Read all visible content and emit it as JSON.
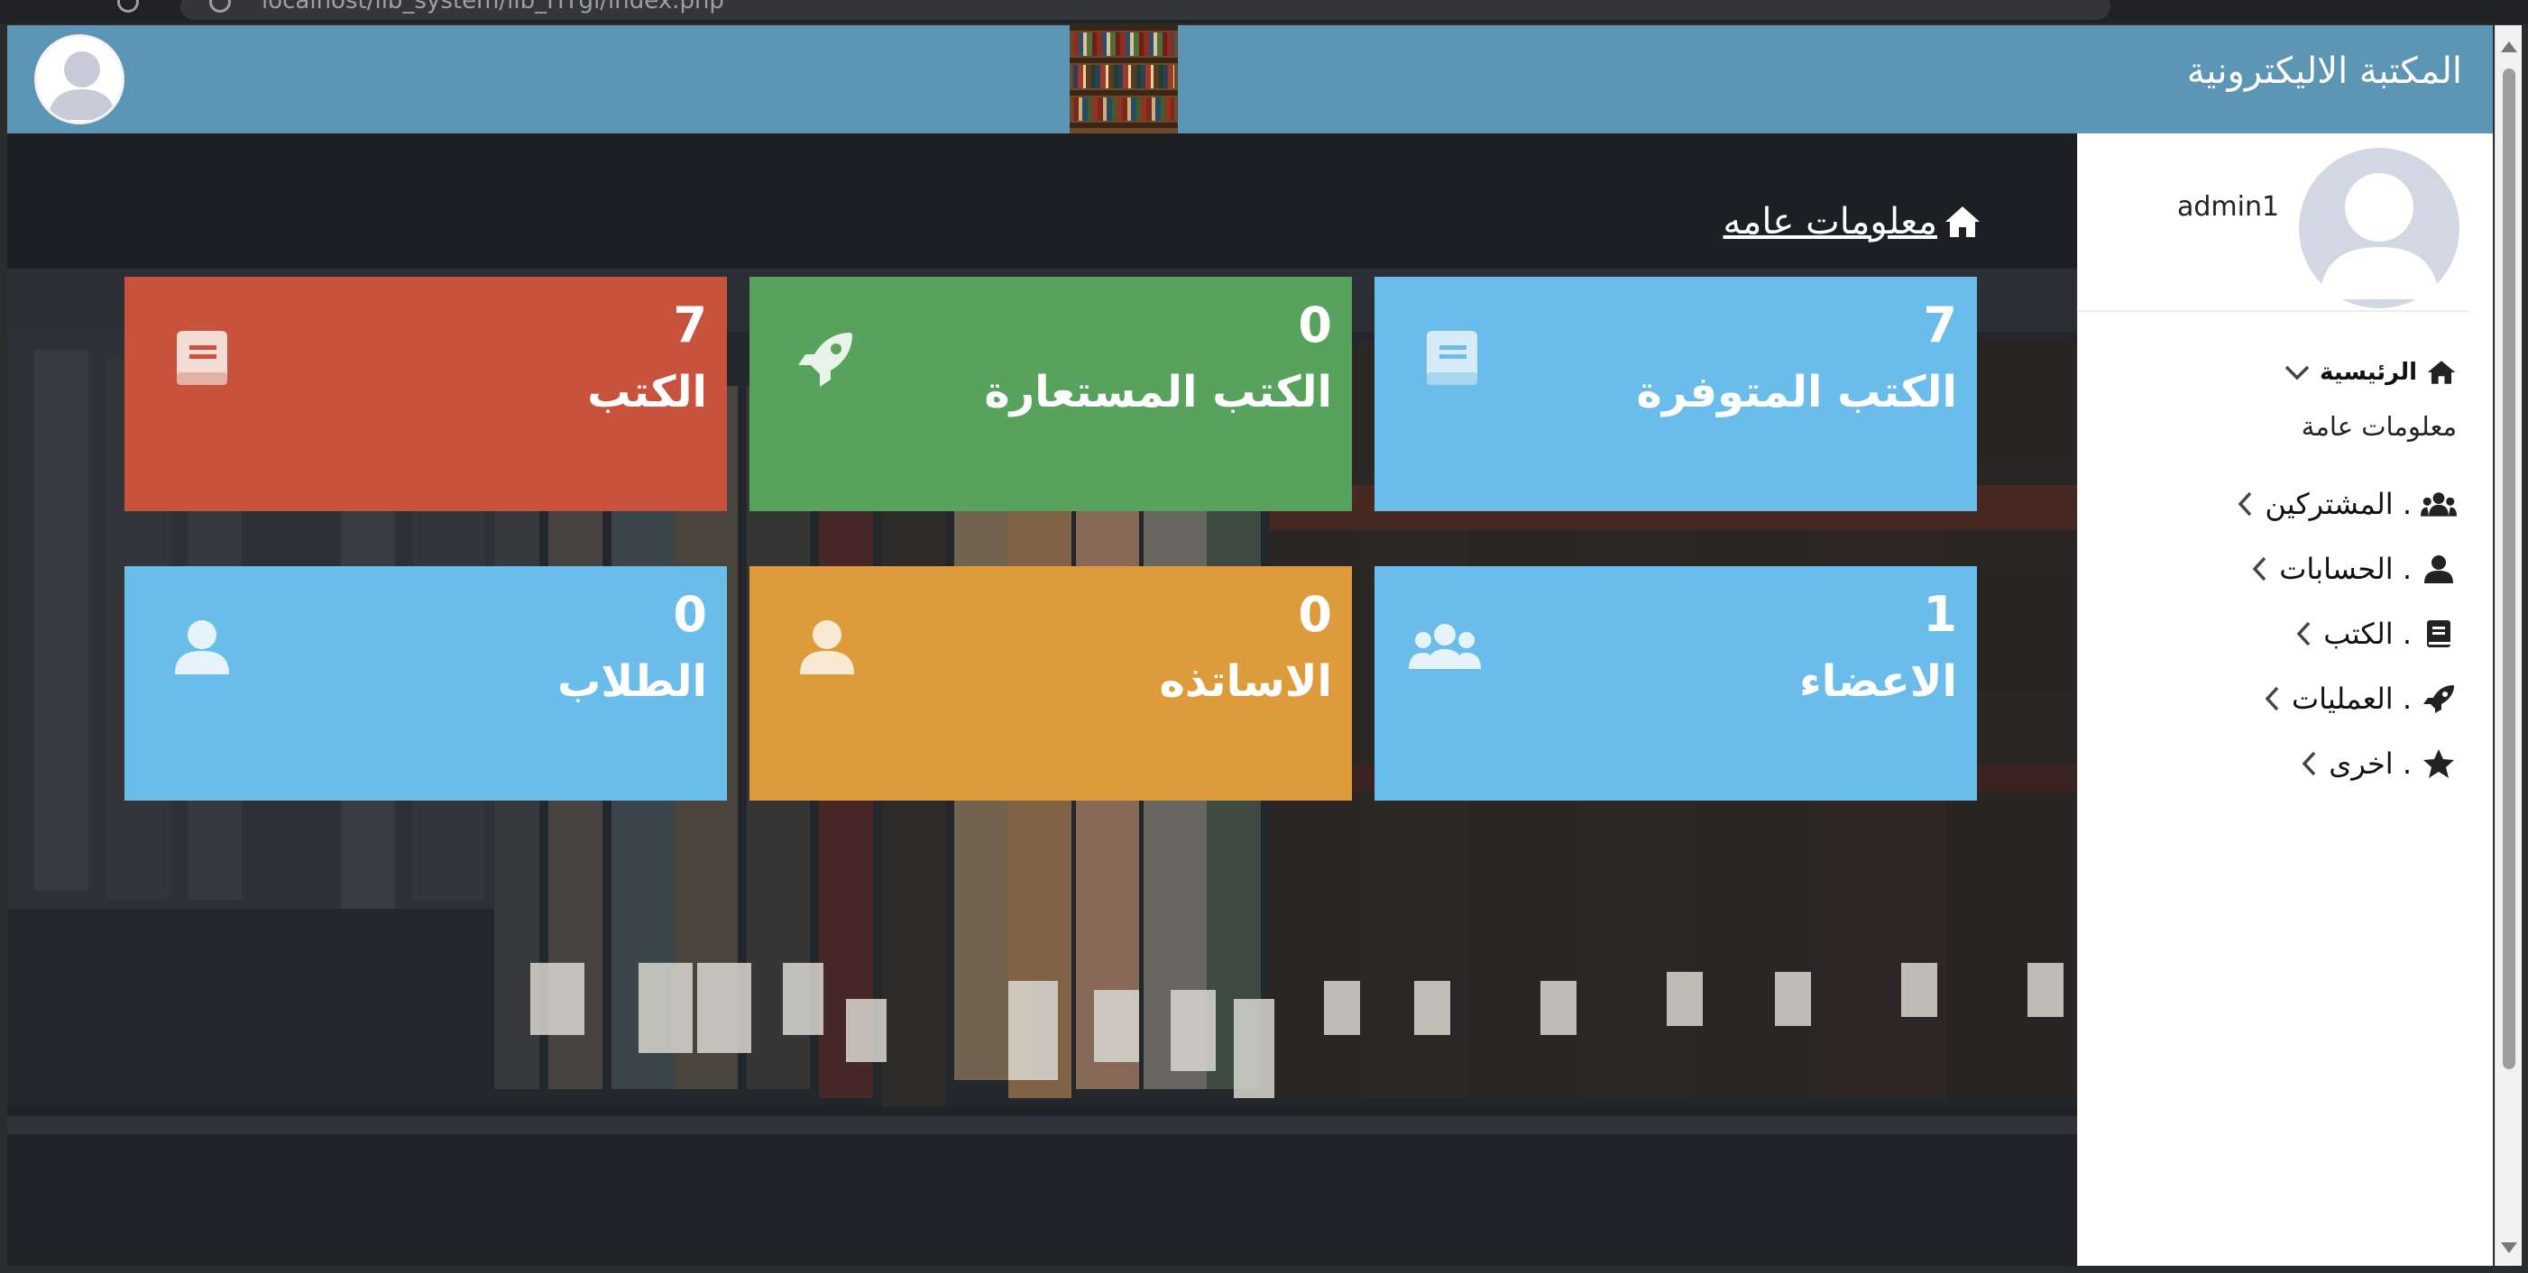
{
  "browser": {
    "url": "localhost/lib_system/lib_HTgl/index.php"
  },
  "header": {
    "brand": "المكتبة الاليكترونية"
  },
  "sidebar": {
    "username": "admin1",
    "home": "الرئيسية",
    "submenu_general": "معلومات عامة",
    "items": [
      {
        "label": ". المشتركين",
        "icon": "users-icon"
      },
      {
        "label": ". الحسابات",
        "icon": "user-icon"
      },
      {
        "label": ". الكتب",
        "icon": "book-icon"
      },
      {
        "label": ". العمليات",
        "icon": "rocket-icon"
      },
      {
        "label": ". اخرى",
        "icon": "star-icon"
      }
    ]
  },
  "main": {
    "section_title": "معلومات عامه",
    "cards": [
      {
        "count": "7",
        "label": "الكتب المتوفرة",
        "color": "#6abcea",
        "icon": "book-icon"
      },
      {
        "count": "0",
        "label": "الكتب المستعارة",
        "color": "#57a35e",
        "icon": "rocket-icon"
      },
      {
        "count": "7",
        "label": "الكتب",
        "color": "#c8523c",
        "icon": "book-icon"
      },
      {
        "count": "1",
        "label": "الاعضاء",
        "color": "#6abcea",
        "icon": "users-icon"
      },
      {
        "count": "0",
        "label": "الاساتذه",
        "color": "#de9b3b",
        "icon": "user-icon"
      },
      {
        "count": "0",
        "label": "الطلاب",
        "color": "#6abcea",
        "icon": "user-icon"
      }
    ]
  }
}
